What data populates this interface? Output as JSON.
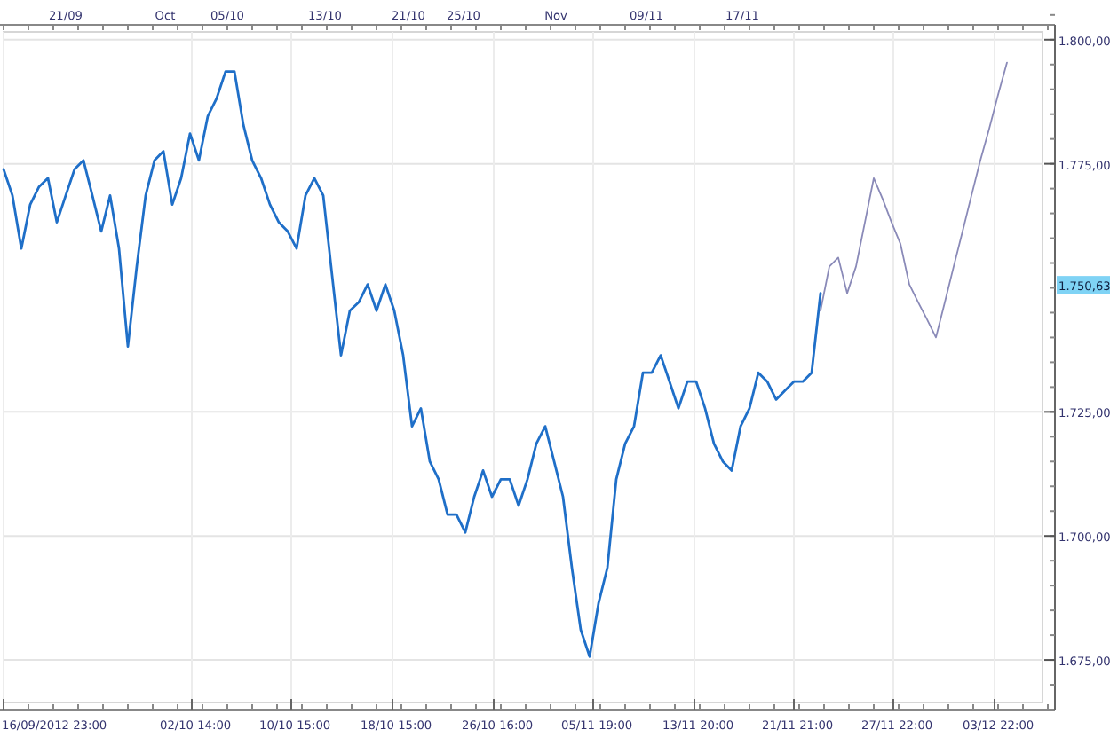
{
  "chart": {
    "chart_data": {
      "type": "line",
      "ylim": [
        1665,
        1803
      ],
      "grid": true,
      "yticks": [
        {
          "value": 1800,
          "label": "1.800,00"
        },
        {
          "value": 1775,
          "label": "1.775,00"
        },
        {
          "value": 1725,
          "label": "1.725,00"
        },
        {
          "value": 1700,
          "label": "1.700,00"
        },
        {
          "value": 1675,
          "label": "1.675,00"
        }
      ],
      "series": [
        {
          "color": "#1f6fc8",
          "values": [
            1773.9,
            1768.6,
            1757.9,
            1766.8,
            1770.4,
            1772.1,
            1763.2,
            1768.6,
            1773.9,
            1775.7,
            1768.6,
            1761.4,
            1768.6,
            1757.9,
            1738.2,
            1754.3,
            1768.6,
            1775.7,
            1777.5,
            1766.8,
            1772.1,
            1781.1,
            1775.7,
            1784.6,
            1788.2,
            1793.6,
            1793.6,
            1782.9,
            1775.7,
            1772.1,
            1766.8,
            1763.2,
            1761.4,
            1757.9,
            1768.6,
            1772.1,
            1768.6,
            1752.5,
            1736.4,
            1745.4,
            1747.1,
            1750.7,
            1745.4,
            1750.7,
            1745.4,
            1736.4,
            1722.1,
            1725.7,
            1715,
            1711.4,
            1704.3,
            1704.3,
            1700.7,
            1707.9,
            1713.2,
            1707.9,
            1711.4,
            1711.4,
            1706.1,
            1711.4,
            1718.6,
            1722.1,
            1715,
            1707.9,
            1693.6,
            1681.1,
            1675.7,
            1686.4,
            1693.6,
            1711.4,
            1718.6,
            1722.1,
            1732.9,
            1732.9,
            1736.4,
            1731.1,
            1725.7,
            1731.1,
            1731.1,
            1725.7,
            1718.6,
            1715,
            1713.2,
            1722.1,
            1725.7,
            1732.9,
            1731.1,
            1727.5,
            1729.3,
            1731.1,
            1731.1,
            1732.9,
            1748.9,
            null,
            null,
            null,
            null,
            null,
            null,
            null,
            null,
            null,
            null,
            null,
            null,
            null,
            null,
            null,
            null,
            null,
            null,
            null,
            null,
            null
          ]
        },
        {
          "color": "#8a8ab8",
          "values": [
            null,
            null,
            null,
            null,
            null,
            null,
            null,
            null,
            null,
            null,
            null,
            null,
            null,
            null,
            null,
            null,
            null,
            null,
            null,
            null,
            null,
            null,
            null,
            null,
            null,
            null,
            null,
            null,
            null,
            null,
            null,
            null,
            null,
            null,
            null,
            null,
            null,
            null,
            null,
            null,
            null,
            null,
            null,
            null,
            null,
            null,
            null,
            null,
            null,
            null,
            null,
            null,
            null,
            null,
            null,
            null,
            null,
            null,
            null,
            null,
            null,
            null,
            null,
            null,
            null,
            null,
            null,
            null,
            null,
            null,
            null,
            null,
            null,
            null,
            null,
            null,
            null,
            null,
            null,
            null,
            null,
            null,
            null,
            null,
            null,
            null,
            null,
            null,
            null,
            null,
            null,
            null,
            1745.4,
            1754.3,
            1756.1,
            1748.9,
            1754.3,
            1763.2,
            1772.1,
            1767.9,
            1763.2,
            1758.9,
            1750.7,
            1747.1,
            1743.6,
            1740,
            1747.1,
            1754.3,
            1761.4,
            1768.6,
            1775.7,
            1782.1,
            1788.9,
            1795.4
          ]
        }
      ]
    },
    "current_price_label": "1.750,63",
    "top_axis_labels": [
      "21/09",
      "Oct",
      "05/10",
      "13/10",
      "21/10",
      "25/10",
      "Nov",
      "09/11",
      "17/11"
    ],
    "bottom_axis_labels": [
      "16/09/2012 23:00",
      "02/10 14:00",
      "10/10 15:00",
      "18/10 15:00",
      "26/10 16:00",
      "05/11 19:00",
      "13/11 20:00",
      "21/11 21:00",
      "27/11 22:00",
      "03/12 22:00"
    ]
  }
}
